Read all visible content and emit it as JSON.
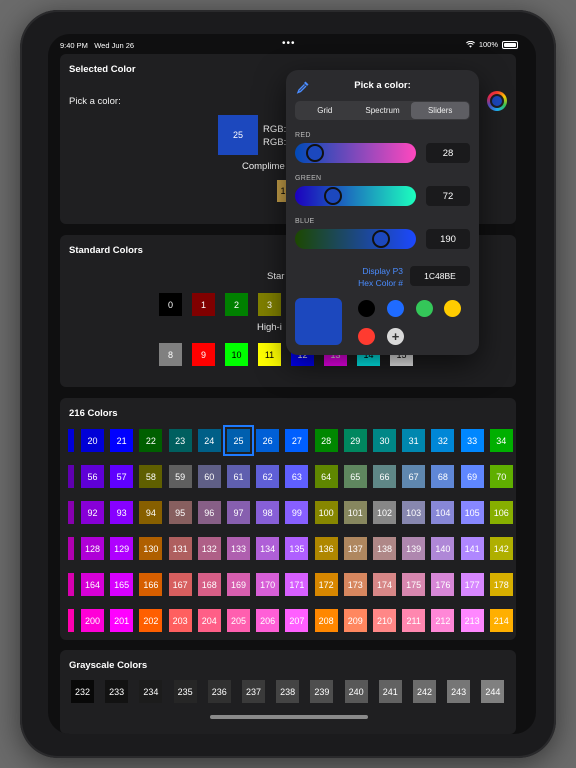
{
  "status_bar": {
    "time": "9:40 PM",
    "date": "Wed Jun 26",
    "battery": "100%"
  },
  "selected_card": {
    "title": "Selected Color",
    "pick_label": "Pick a color:",
    "swatch_value": "25",
    "rgb_line1": "RGB:",
    "rgb_line2": "RGB:",
    "complement_label": "Complime",
    "complement_value": "1"
  },
  "standard_card": {
    "title": "Standard Colors",
    "standard_label": "Star",
    "highint_label": "High-i",
    "standard": [
      {
        "label": "0",
        "bg": "#000000",
        "fg": "#ffffff"
      },
      {
        "label": "1",
        "bg": "#800000",
        "fg": "#ffffff"
      },
      {
        "label": "2",
        "bg": "#008000",
        "fg": "#ffffff"
      },
      {
        "label": "3",
        "bg": "#808000",
        "fg": "#ffffff"
      }
    ],
    "high": [
      {
        "label": "8",
        "bg": "#808080",
        "fg": "#ffffff"
      },
      {
        "label": "9",
        "bg": "#ff0000",
        "fg": "#ffffff"
      },
      {
        "label": "10",
        "bg": "#00ff00",
        "fg": "#000000"
      },
      {
        "label": "11",
        "bg": "#ffff00",
        "fg": "#000000"
      },
      {
        "label": "12",
        "bg": "#0000ff",
        "fg": "#ffffff"
      },
      {
        "label": "13",
        "bg": "#ff00ff",
        "fg": "#ffffff"
      },
      {
        "label": "14",
        "bg": "#00ffff",
        "fg": "#000000"
      },
      {
        "label": "15",
        "bg": "#ffffff",
        "fg": "#000000"
      }
    ]
  },
  "c216_card": {
    "title": "216 Colors",
    "selected_value": "25",
    "rows": [
      {
        "lead": "#0000d7",
        "cells": [
          {
            "label": "20",
            "bg": "#0000d7"
          },
          {
            "label": "21",
            "bg": "#0000ff"
          },
          {
            "label": "22",
            "bg": "#005f00"
          },
          {
            "label": "23",
            "bg": "#005f5f"
          },
          {
            "label": "24",
            "bg": "#005f87"
          },
          {
            "label": "25",
            "bg": "#005faf"
          },
          {
            "label": "26",
            "bg": "#005fd7"
          },
          {
            "label": "27",
            "bg": "#005fff"
          },
          {
            "label": "28",
            "bg": "#008700"
          },
          {
            "label": "29",
            "bg": "#00875f"
          },
          {
            "label": "30",
            "bg": "#008787"
          },
          {
            "label": "31",
            "bg": "#0087af"
          },
          {
            "label": "32",
            "bg": "#0087d7"
          },
          {
            "label": "33",
            "bg": "#0087ff"
          },
          {
            "label": "34",
            "bg": "#00af00"
          }
        ]
      },
      {
        "lead": "#5f00af",
        "cells": [
          {
            "label": "56",
            "bg": "#5f00d7"
          },
          {
            "label": "57",
            "bg": "#5f00ff"
          },
          {
            "label": "58",
            "bg": "#5f5f00"
          },
          {
            "label": "59",
            "bg": "#5f5f5f"
          },
          {
            "label": "60",
            "bg": "#5f5f87"
          },
          {
            "label": "61",
            "bg": "#5f5faf"
          },
          {
            "label": "62",
            "bg": "#5f5fd7"
          },
          {
            "label": "63",
            "bg": "#5f5fff"
          },
          {
            "label": "64",
            "bg": "#5f8700"
          },
          {
            "label": "65",
            "bg": "#5f875f"
          },
          {
            "label": "66",
            "bg": "#5f8787"
          },
          {
            "label": "67",
            "bg": "#5f87af"
          },
          {
            "label": "68",
            "bg": "#5f87d7"
          },
          {
            "label": "69",
            "bg": "#5f87ff"
          },
          {
            "label": "70",
            "bg": "#5faf00"
          }
        ]
      },
      {
        "lead": "#8700af",
        "cells": [
          {
            "label": "92",
            "bg": "#8700d7"
          },
          {
            "label": "93",
            "bg": "#8700ff"
          },
          {
            "label": "94",
            "bg": "#875f00"
          },
          {
            "label": "95",
            "bg": "#875f5f"
          },
          {
            "label": "96",
            "bg": "#875f87"
          },
          {
            "label": "97",
            "bg": "#875faf"
          },
          {
            "label": "98",
            "bg": "#875fd7"
          },
          {
            "label": "99",
            "bg": "#875fff"
          },
          {
            "label": "100",
            "bg": "#878700"
          },
          {
            "label": "101",
            "bg": "#87875f"
          },
          {
            "label": "102",
            "bg": "#878787"
          },
          {
            "label": "103",
            "bg": "#8787af"
          },
          {
            "label": "104",
            "bg": "#8787d7"
          },
          {
            "label": "105",
            "bg": "#8787ff"
          },
          {
            "label": "106",
            "bg": "#87af00"
          }
        ]
      },
      {
        "lead": "#af00af",
        "cells": [
          {
            "label": "128",
            "bg": "#af00d7"
          },
          {
            "label": "129",
            "bg": "#af00ff"
          },
          {
            "label": "130",
            "bg": "#af5f00"
          },
          {
            "label": "131",
            "bg": "#af5f5f"
          },
          {
            "label": "132",
            "bg": "#af5f87"
          },
          {
            "label": "133",
            "bg": "#af5faf"
          },
          {
            "label": "134",
            "bg": "#af5fd7"
          },
          {
            "label": "135",
            "bg": "#af5fff"
          },
          {
            "label": "136",
            "bg": "#af8700"
          },
          {
            "label": "137",
            "bg": "#af875f"
          },
          {
            "label": "138",
            "bg": "#af8787"
          },
          {
            "label": "139",
            "bg": "#af87af"
          },
          {
            "label": "140",
            "bg": "#af87d7"
          },
          {
            "label": "141",
            "bg": "#af87ff"
          },
          {
            "label": "142",
            "bg": "#afaf00"
          }
        ]
      },
      {
        "lead": "#d700af",
        "cells": [
          {
            "label": "164",
            "bg": "#d700d7"
          },
          {
            "label": "165",
            "bg": "#d700ff"
          },
          {
            "label": "166",
            "bg": "#d75f00"
          },
          {
            "label": "167",
            "bg": "#d75f5f"
          },
          {
            "label": "168",
            "bg": "#d75f87"
          },
          {
            "label": "169",
            "bg": "#d75faf"
          },
          {
            "label": "170",
            "bg": "#d75fd7"
          },
          {
            "label": "171",
            "bg": "#d75fff"
          },
          {
            "label": "172",
            "bg": "#d78700"
          },
          {
            "label": "173",
            "bg": "#d7875f"
          },
          {
            "label": "174",
            "bg": "#d78787"
          },
          {
            "label": "175",
            "bg": "#d787af"
          },
          {
            "label": "176",
            "bg": "#d787d7"
          },
          {
            "label": "177",
            "bg": "#d787ff"
          },
          {
            "label": "178",
            "bg": "#d7af00"
          }
        ]
      },
      {
        "lead": "#ff00af",
        "cells": [
          {
            "label": "200",
            "bg": "#ff00d7"
          },
          {
            "label": "201",
            "bg": "#ff00ff"
          },
          {
            "label": "202",
            "bg": "#ff5f00"
          },
          {
            "label": "203",
            "bg": "#ff5f5f"
          },
          {
            "label": "204",
            "bg": "#ff5f87"
          },
          {
            "label": "205",
            "bg": "#ff5faf"
          },
          {
            "label": "206",
            "bg": "#ff5fd7"
          },
          {
            "label": "207",
            "bg": "#ff5fff"
          },
          {
            "label": "208",
            "bg": "#ff8700"
          },
          {
            "label": "209",
            "bg": "#ff875f"
          },
          {
            "label": "210",
            "bg": "#ff8787"
          },
          {
            "label": "211",
            "bg": "#ff87af"
          },
          {
            "label": "212",
            "bg": "#ff87d7"
          },
          {
            "label": "213",
            "bg": "#ff87ff"
          },
          {
            "label": "214",
            "bg": "#ffaf00"
          }
        ]
      }
    ]
  },
  "gray_card": {
    "title": "Grayscale Colors",
    "cells": [
      {
        "label": "232",
        "bg": "#080808"
      },
      {
        "label": "233",
        "bg": "#121212"
      },
      {
        "label": "234",
        "bg": "#1c1c1c"
      },
      {
        "label": "235",
        "bg": "#262626"
      },
      {
        "label": "236",
        "bg": "#303030"
      },
      {
        "label": "237",
        "bg": "#3a3a3a"
      },
      {
        "label": "238",
        "bg": "#444444"
      },
      {
        "label": "239",
        "bg": "#4e4e4e"
      },
      {
        "label": "240",
        "bg": "#585858"
      },
      {
        "label": "241",
        "bg": "#626262"
      },
      {
        "label": "242",
        "bg": "#6c6c6c"
      },
      {
        "label": "243",
        "bg": "#767676"
      },
      {
        "label": "244",
        "bg": "#808080"
      }
    ]
  },
  "picker": {
    "title": "Pick a color:",
    "tabs": [
      "Grid",
      "Spectrum",
      "Sliders"
    ],
    "active_tab": "Sliders",
    "red": {
      "label": "RED",
      "value": "28",
      "fraction": 0.11
    },
    "green": {
      "label": "GREEN",
      "value": "72",
      "fraction": 0.28
    },
    "blue": {
      "label": "BLUE",
      "value": "190",
      "fraction": 0.75
    },
    "display_p3": "Display P3",
    "hex_label": "Hex Color #",
    "hex_value": "1C48BE",
    "current_color": "#1c48be",
    "presets": [
      "#000000",
      "#1f6bff",
      "#34c759",
      "#ffcc00",
      "#ff3b30"
    ]
  },
  "colors": {
    "accent": "#1f7bff",
    "card_bg": "#1f1f21",
    "screen_bg": "#0f0f10"
  }
}
